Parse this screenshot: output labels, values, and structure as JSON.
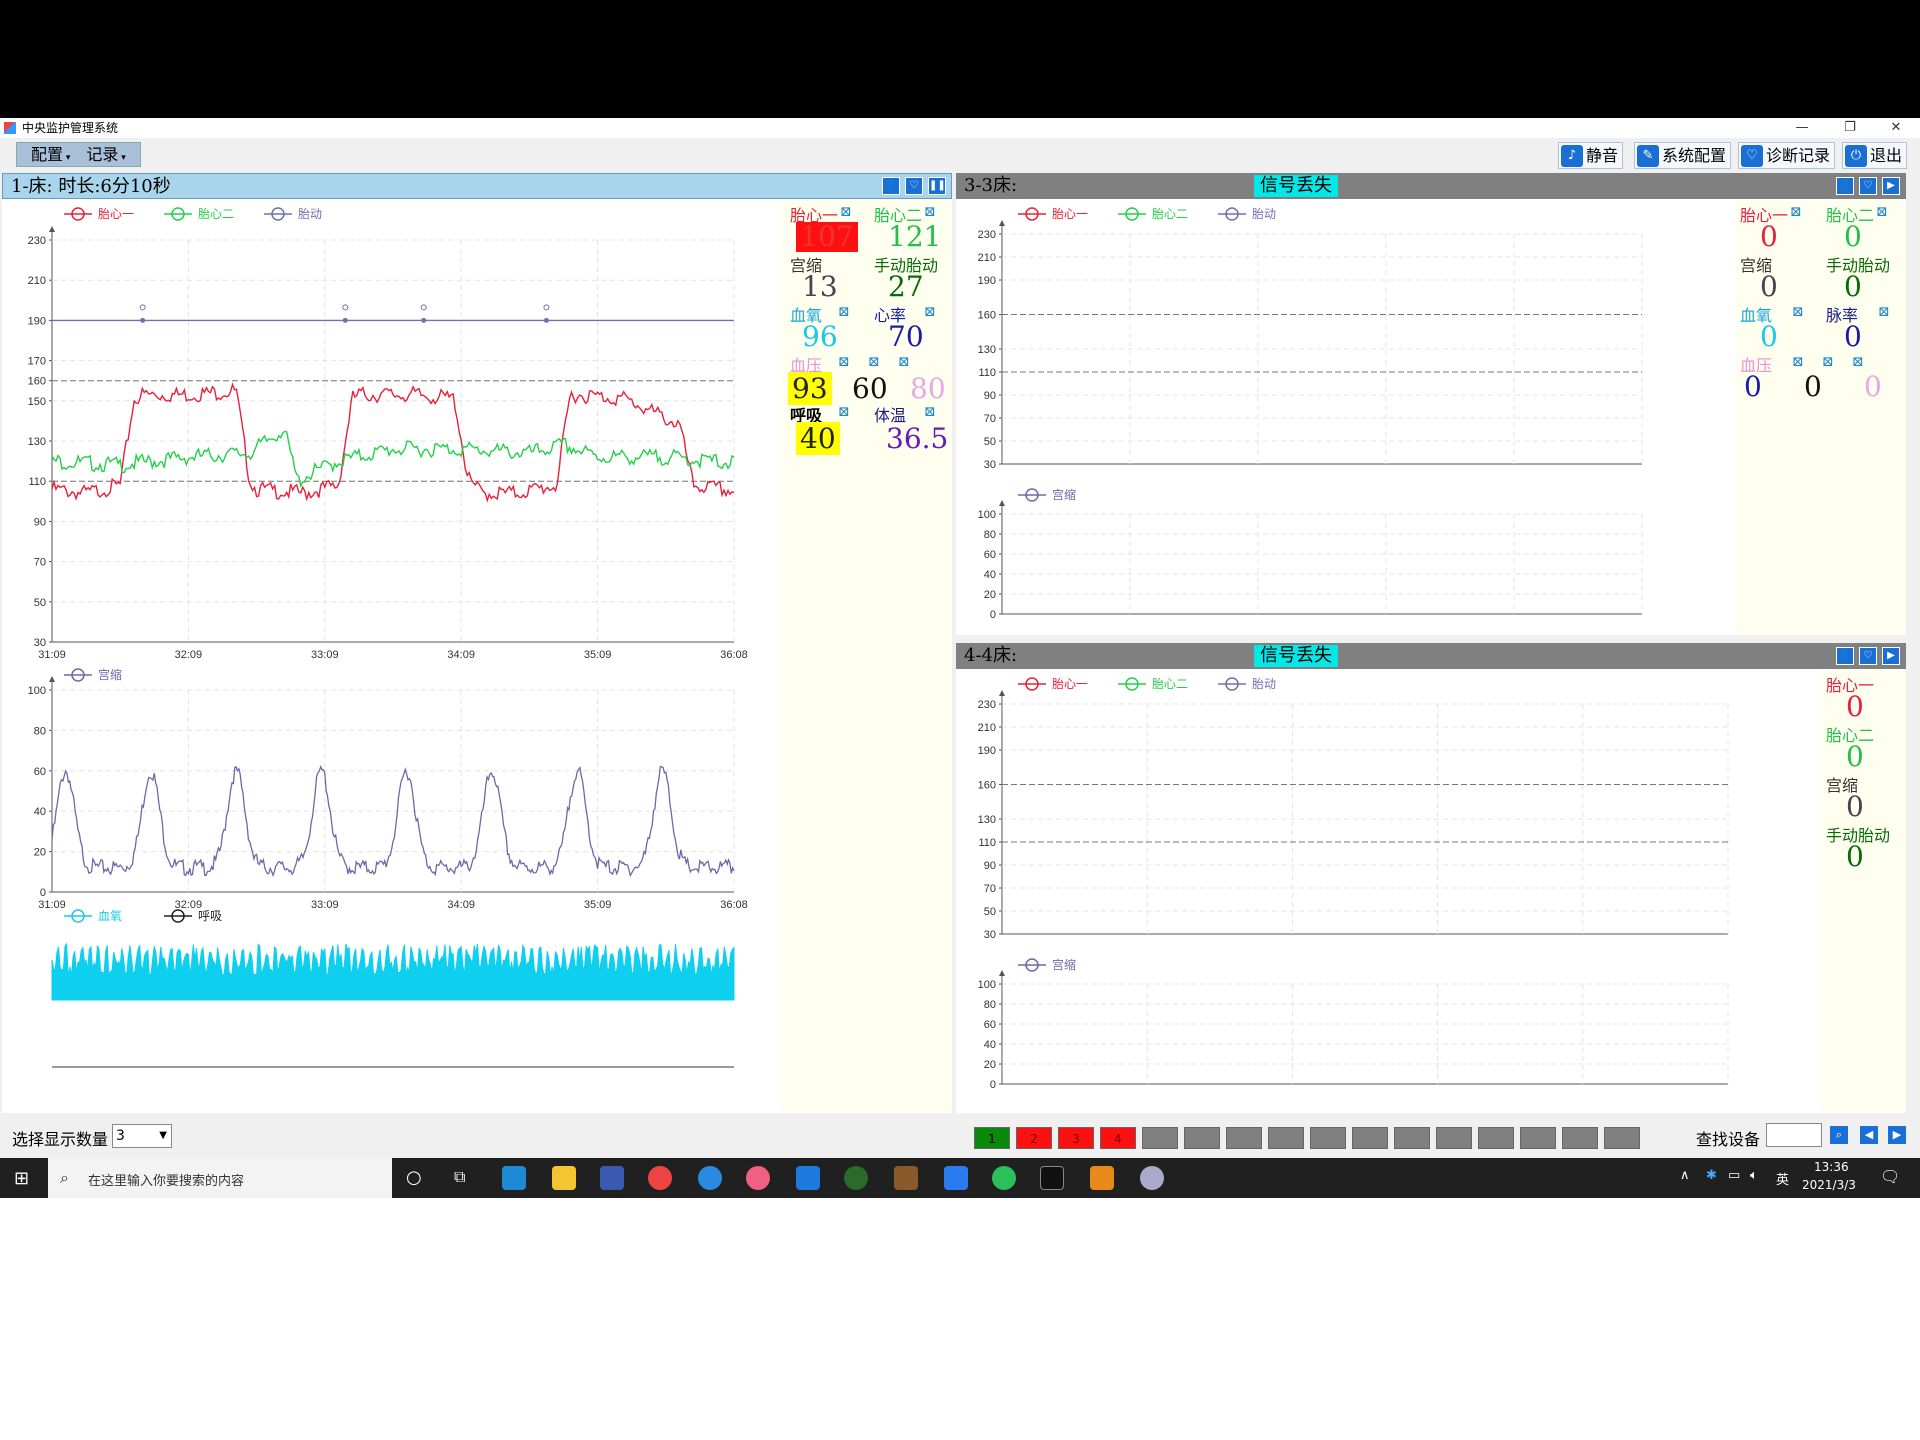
{
  "window": {
    "title": "中央监护管理系统"
  },
  "menu": {
    "config": "配置",
    "record": "记录"
  },
  "toolbar": {
    "mute": "静音",
    "settings": "系统配置",
    "diag": "诊断记录",
    "exit": "退出"
  },
  "bed1": {
    "header": "1-床:   时长:6分10秒",
    "legend": {
      "fhr1": "胎心一",
      "fhr2": "胎心二",
      "fm": "胎动",
      "toco": "宫缩",
      "spo2": "血氧",
      "resp": "呼吸"
    },
    "x_ticks": [
      "31:09",
      "32:09",
      "33:09",
      "34:09",
      "35:09",
      "36:08"
    ],
    "params": {
      "fhr1_label": "胎心一",
      "fhr1_value": "107",
      "fhr2_label": "胎心二",
      "fhr2_value": "121",
      "toco_label": "宫缩",
      "toco_value": "13",
      "fm_label": "手动胎动",
      "fm_value": "27",
      "spo2_label": "血氧",
      "spo2_value": "96",
      "hr_label": "心率",
      "hr_value": "70",
      "bp_label": "血压",
      "bp_sys": "93",
      "bp_dia": "60",
      "bp_mean": "80",
      "resp_label": "呼吸",
      "resp_value": "40",
      "temp_label": "体温",
      "temp_value": "36.5"
    }
  },
  "bed3": {
    "header": "3-3床:",
    "lost": "信号丢失",
    "legend": {
      "fhr1": "胎心一",
      "fhr2": "胎心二",
      "fm": "胎动",
      "toco": "宫缩"
    },
    "params": {
      "fhr1_label": "胎心一",
      "fhr1_value": "0",
      "fhr2_label": "胎心二",
      "fhr2_value": "0",
      "toco_label": "宫缩",
      "toco_value": "0",
      "fm_label": "手动胎动",
      "fm_value": "0",
      "spo2_label": "血氧",
      "spo2_value": "0",
      "pr_label": "脉率",
      "pr_value": "0",
      "bp_label": "血压",
      "bp_sys": "0",
      "bp_dia": "0",
      "bp_mean": "0"
    }
  },
  "bed4": {
    "header": "4-4床:",
    "lost": "信号丢失",
    "legend": {
      "fhr1": "胎心一",
      "fhr2": "胎心二",
      "fm": "胎动",
      "toco": "宫缩"
    },
    "params": {
      "fhr1_label": "胎心一",
      "fhr1_value": "0",
      "fhr2_label": "胎心二",
      "fhr2_value": "0",
      "toco_label": "宫缩",
      "toco_value": "0",
      "fm_label": "手动胎动",
      "fm_value": "0"
    }
  },
  "chart_data": [
    {
      "type": "line",
      "x_ticks": [
        "31:09",
        "32:09",
        "33:09",
        "34:09",
        "35:09",
        "36:08"
      ],
      "y_ticks": [
        30,
        50,
        70,
        90,
        110,
        130,
        150,
        160,
        170,
        190,
        210,
        230
      ],
      "ylim": [
        30,
        230
      ],
      "reference_lines": [
        110,
        160
      ],
      "series": [
        {
          "name": "胎心一",
          "color": "#e8203a",
          "x": [
            0,
            0.05,
            0.1,
            0.12,
            0.13,
            0.2,
            0.27,
            0.29,
            0.3,
            0.37,
            0.42,
            0.44,
            0.45,
            0.53,
            0.59,
            0.61,
            0.63,
            0.68,
            0.74,
            0.76,
            0.77,
            0.84,
            0.92,
            0.94,
            1
          ],
          "values": [
            108,
            106,
            110,
            152,
            155,
            155,
            157,
            112,
            108,
            106,
            110,
            153,
            155,
            155,
            153,
            113,
            106,
            106,
            110,
            155,
            155,
            153,
            140,
            110,
            107
          ]
        },
        {
          "name": "胎心二",
          "color": "#22d04a",
          "x": [
            0,
            0.1,
            0.2,
            0.29,
            0.34,
            0.36,
            0.38,
            0.42,
            0.5,
            0.6,
            0.7,
            0.75,
            0.8,
            0.9,
            1
          ],
          "values": [
            122,
            120,
            124,
            126,
            138,
            112,
            116,
            122,
            128,
            128,
            126,
            130,
            124,
            124,
            121
          ]
        },
        {
          "name": "胎动",
          "color": "#7070b0",
          "x": [
            0,
            1
          ],
          "values": [
            190,
            190
          ],
          "markers_x": [
            0.133,
            0.43,
            0.545,
            0.725
          ]
        }
      ]
    },
    {
      "type": "line",
      "x_ticks": [
        "31:09",
        "32:09",
        "33:09",
        "34:09",
        "35:09",
        "36:08"
      ],
      "y_ticks": [
        0,
        20,
        40,
        60,
        80,
        100
      ],
      "ylim": [
        0,
        100
      ],
      "series": [
        {
          "name": "宫缩",
          "color": "#6a6aa8",
          "peaks_x": [
            0.02,
            0.145,
            0.27,
            0.395,
            0.52,
            0.645,
            0.77,
            0.895
          ],
          "peak_value": 60,
          "baseline": 12
        }
      ]
    }
  ],
  "status": {
    "select_label": "选择显示数量",
    "select_value": "3",
    "find_label": "查找设备",
    "slots": [
      "1",
      "2",
      "3",
      "4"
    ]
  },
  "taskbar": {
    "search": "在这里输入你要搜索的内容",
    "time": "13:36",
    "date": "2021/3/3",
    "ime": "英"
  }
}
